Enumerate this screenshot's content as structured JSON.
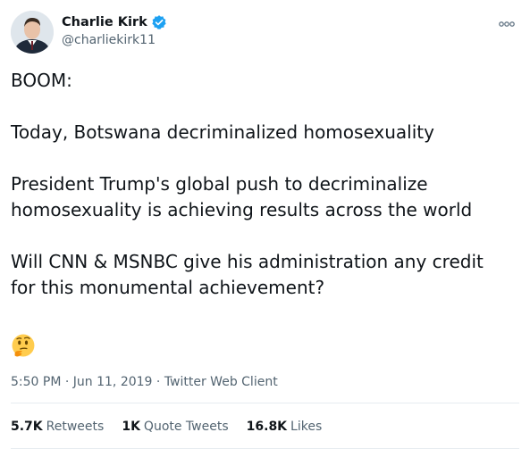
{
  "author": {
    "display_name": "Charlie Kirk",
    "handle": "@charliekirk11",
    "verified": true
  },
  "tweet": {
    "text": "BOOM:\n\nToday, Botswana decriminalized homosexuality\n\nPresident Trump's global push to decriminalize\nhomosexuality is achieving results across the world\n\nWill CNN & MSNBC give his administration any credit\nfor this monumental achievement?",
    "emoji": "thinking-face-icon"
  },
  "meta": {
    "time": "5:50 PM",
    "separator": " · ",
    "date": "Jun 11, 2019",
    "source": "Twitter Web Client"
  },
  "stats": {
    "retweets_count": "5.7K",
    "retweets_label": "Retweets",
    "quotes_count": "1K",
    "quotes_label": "Quote Tweets",
    "likes_count": "16.8K",
    "likes_label": "Likes"
  },
  "colors": {
    "verified_blue": "#1da1f2",
    "secondary_text": "#536471",
    "primary_text": "#0f1419"
  }
}
